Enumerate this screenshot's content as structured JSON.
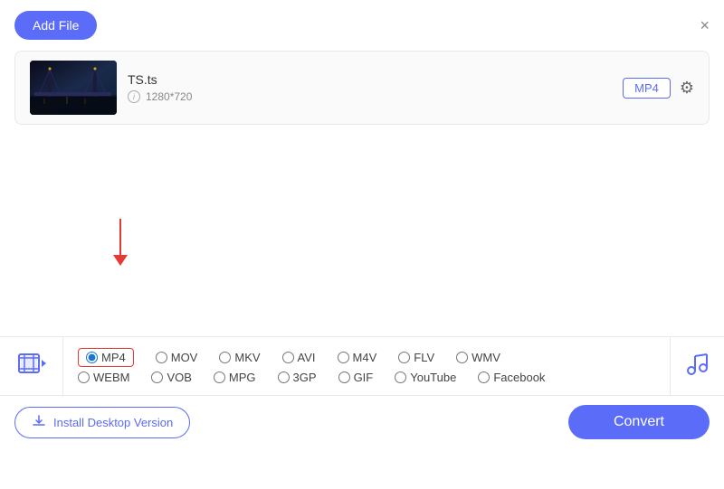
{
  "header": {
    "add_file_label": "Add File",
    "close_icon": "×"
  },
  "file": {
    "thumbnail_alt": "Video thumbnail",
    "name": "TS.ts",
    "info_icon": "i",
    "resolution": "1280*720",
    "format": "MP4",
    "settings_icon": "⚙"
  },
  "arrow": {
    "color": "#e53935"
  },
  "format_panel": {
    "video_icon": "🎬",
    "music_icon": "♫",
    "row1": [
      {
        "id": "mp4",
        "label": "MP4",
        "selected": true
      },
      {
        "id": "mov",
        "label": "MOV",
        "selected": false
      },
      {
        "id": "mkv",
        "label": "MKV",
        "selected": false
      },
      {
        "id": "avi",
        "label": "AVI",
        "selected": false
      },
      {
        "id": "m4v",
        "label": "M4V",
        "selected": false
      },
      {
        "id": "flv",
        "label": "FLV",
        "selected": false
      },
      {
        "id": "wmv",
        "label": "WMV",
        "selected": false
      }
    ],
    "row2": [
      {
        "id": "webm",
        "label": "WEBM",
        "selected": false
      },
      {
        "id": "vob",
        "label": "VOB",
        "selected": false
      },
      {
        "id": "mpg",
        "label": "MPG",
        "selected": false
      },
      {
        "id": "3gp",
        "label": "3GP",
        "selected": false
      },
      {
        "id": "gif",
        "label": "GIF",
        "selected": false
      },
      {
        "id": "youtube",
        "label": "YouTube",
        "selected": false
      },
      {
        "id": "facebook",
        "label": "Facebook",
        "selected": false
      }
    ]
  },
  "footer": {
    "install_icon": "⬇",
    "install_label": "Install Desktop Version",
    "convert_label": "Convert"
  }
}
